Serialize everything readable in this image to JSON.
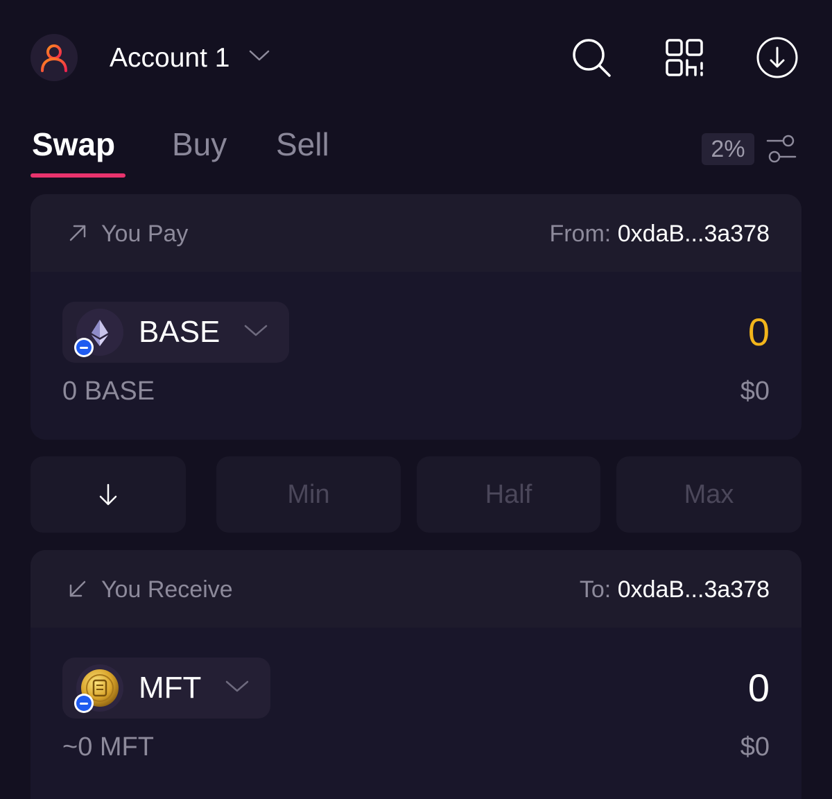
{
  "header": {
    "account_name": "Account 1",
    "icons": [
      "user-icon",
      "chevron-down-icon",
      "search-icon",
      "qr-code-icon",
      "download-icon"
    ]
  },
  "tabs": [
    {
      "label": "Swap",
      "active": true
    },
    {
      "label": "Buy",
      "active": false
    },
    {
      "label": "Sell",
      "active": false
    }
  ],
  "slippage": "2%",
  "pay": {
    "label": "You Pay",
    "from_prefix": "From:",
    "address": "0xdaB...3a378",
    "token": "BASE",
    "amount": "0",
    "balance": "0 BASE",
    "fiat": "$0"
  },
  "actions": {
    "min": "Min",
    "half": "Half",
    "max": "Max"
  },
  "receive": {
    "label": "You Receive",
    "to_prefix": "To:",
    "address": "0xdaB...3a378",
    "token": "MFT",
    "amount": "0",
    "balance": "~0 MFT",
    "fiat": "$0"
  },
  "colors": {
    "background": "#131020",
    "card": "#1b1829",
    "accent": "#e8336d",
    "pay_amount": "#f2b51b",
    "muted_text": "#8d8a9b"
  }
}
